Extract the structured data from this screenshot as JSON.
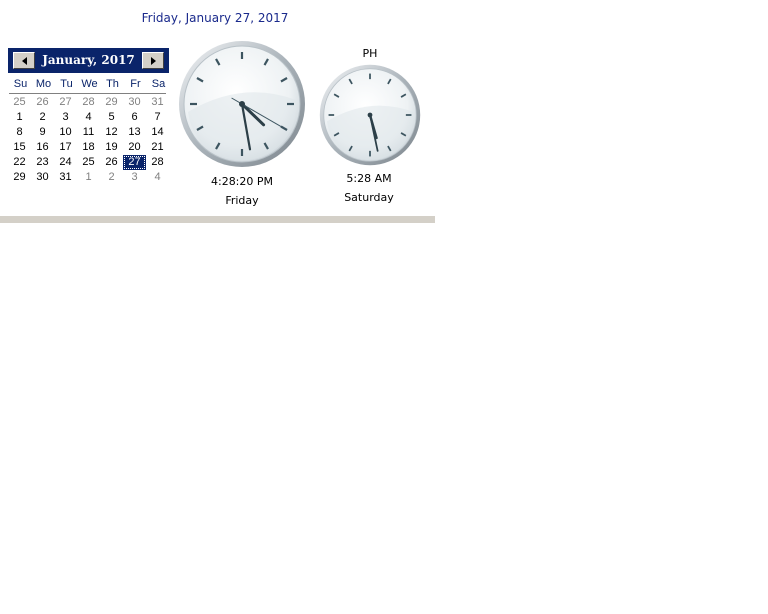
{
  "date_heading": "Friday, January 27, 2017",
  "calendar": {
    "month_title": "January, 2017",
    "weekdays": [
      "Su",
      "Mo",
      "Tu",
      "We",
      "Th",
      "Fr",
      "Sa"
    ],
    "days": [
      {
        "d": "25",
        "other": true
      },
      {
        "d": "26",
        "other": true
      },
      {
        "d": "27",
        "other": true
      },
      {
        "d": "28",
        "other": true
      },
      {
        "d": "29",
        "other": true
      },
      {
        "d": "30",
        "other": true
      },
      {
        "d": "31",
        "other": true
      },
      {
        "d": "1"
      },
      {
        "d": "2"
      },
      {
        "d": "3"
      },
      {
        "d": "4"
      },
      {
        "d": "5"
      },
      {
        "d": "6"
      },
      {
        "d": "7"
      },
      {
        "d": "8"
      },
      {
        "d": "9"
      },
      {
        "d": "10"
      },
      {
        "d": "11"
      },
      {
        "d": "12"
      },
      {
        "d": "13"
      },
      {
        "d": "14"
      },
      {
        "d": "15"
      },
      {
        "d": "16"
      },
      {
        "d": "17"
      },
      {
        "d": "18"
      },
      {
        "d": "19"
      },
      {
        "d": "20"
      },
      {
        "d": "21"
      },
      {
        "d": "22"
      },
      {
        "d": "23"
      },
      {
        "d": "24"
      },
      {
        "d": "25"
      },
      {
        "d": "26"
      },
      {
        "d": "27",
        "selected": true
      },
      {
        "d": "28"
      },
      {
        "d": "29"
      },
      {
        "d": "30"
      },
      {
        "d": "31"
      },
      {
        "d": "1",
        "other": true
      },
      {
        "d": "2",
        "other": true
      },
      {
        "d": "3",
        "other": true
      },
      {
        "d": "4",
        "other": true
      }
    ],
    "colors": {
      "header_bg": "#0a246a",
      "selected_bg": "#0a246a",
      "other_month": "#808080"
    }
  },
  "local_clock": {
    "time_text": "4:28:20 PM",
    "day_text": "Friday",
    "hours": 4,
    "minutes": 28,
    "seconds": 20
  },
  "world_clock": {
    "zone_label": "PH",
    "time_text": "5:28 AM",
    "day_text": "Saturday",
    "hours": 5,
    "minutes": 28
  }
}
